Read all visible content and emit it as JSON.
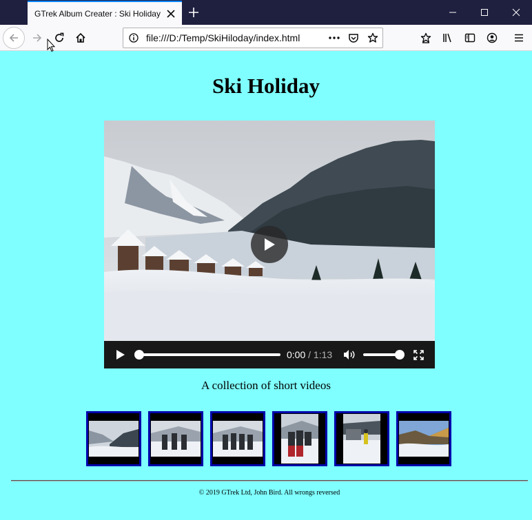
{
  "browser": {
    "tab_title": "GTrek Album Creater : Ski Holiday",
    "url": "file:///D:/Temp/SkiHiloday/index.html"
  },
  "page": {
    "title": "Ski Holiday",
    "caption": "A collection of short videos",
    "footer": "© 2019 GTrek Ltd, John Bird. All wrongs reversed"
  },
  "video": {
    "current_time": "0:00",
    "separator": " / ",
    "duration": "1:13",
    "progress": 0.0,
    "volume": 1.0
  },
  "thumbnails": [
    {
      "name": "thumb-1"
    },
    {
      "name": "thumb-2"
    },
    {
      "name": "thumb-3"
    },
    {
      "name": "thumb-4"
    },
    {
      "name": "thumb-5"
    },
    {
      "name": "thumb-6"
    }
  ],
  "colors": {
    "page_background": "#7fffff",
    "thumb_border": "#0000aa",
    "titlebar": "#1f1f3f",
    "tab_accent": "#0a84ff"
  },
  "icons": [
    "close-icon",
    "plus-icon",
    "minimize-icon",
    "maximize-icon",
    "back-arrow-icon",
    "forward-arrow-icon",
    "reload-icon",
    "home-icon",
    "info-icon",
    "more-icon",
    "pocket-icon",
    "star-icon",
    "bookmarks-menu-icon",
    "library-icon",
    "sidebar-icon",
    "account-icon",
    "hamburger-menu-icon",
    "play-icon",
    "volume-icon",
    "fullscreen-icon"
  ]
}
